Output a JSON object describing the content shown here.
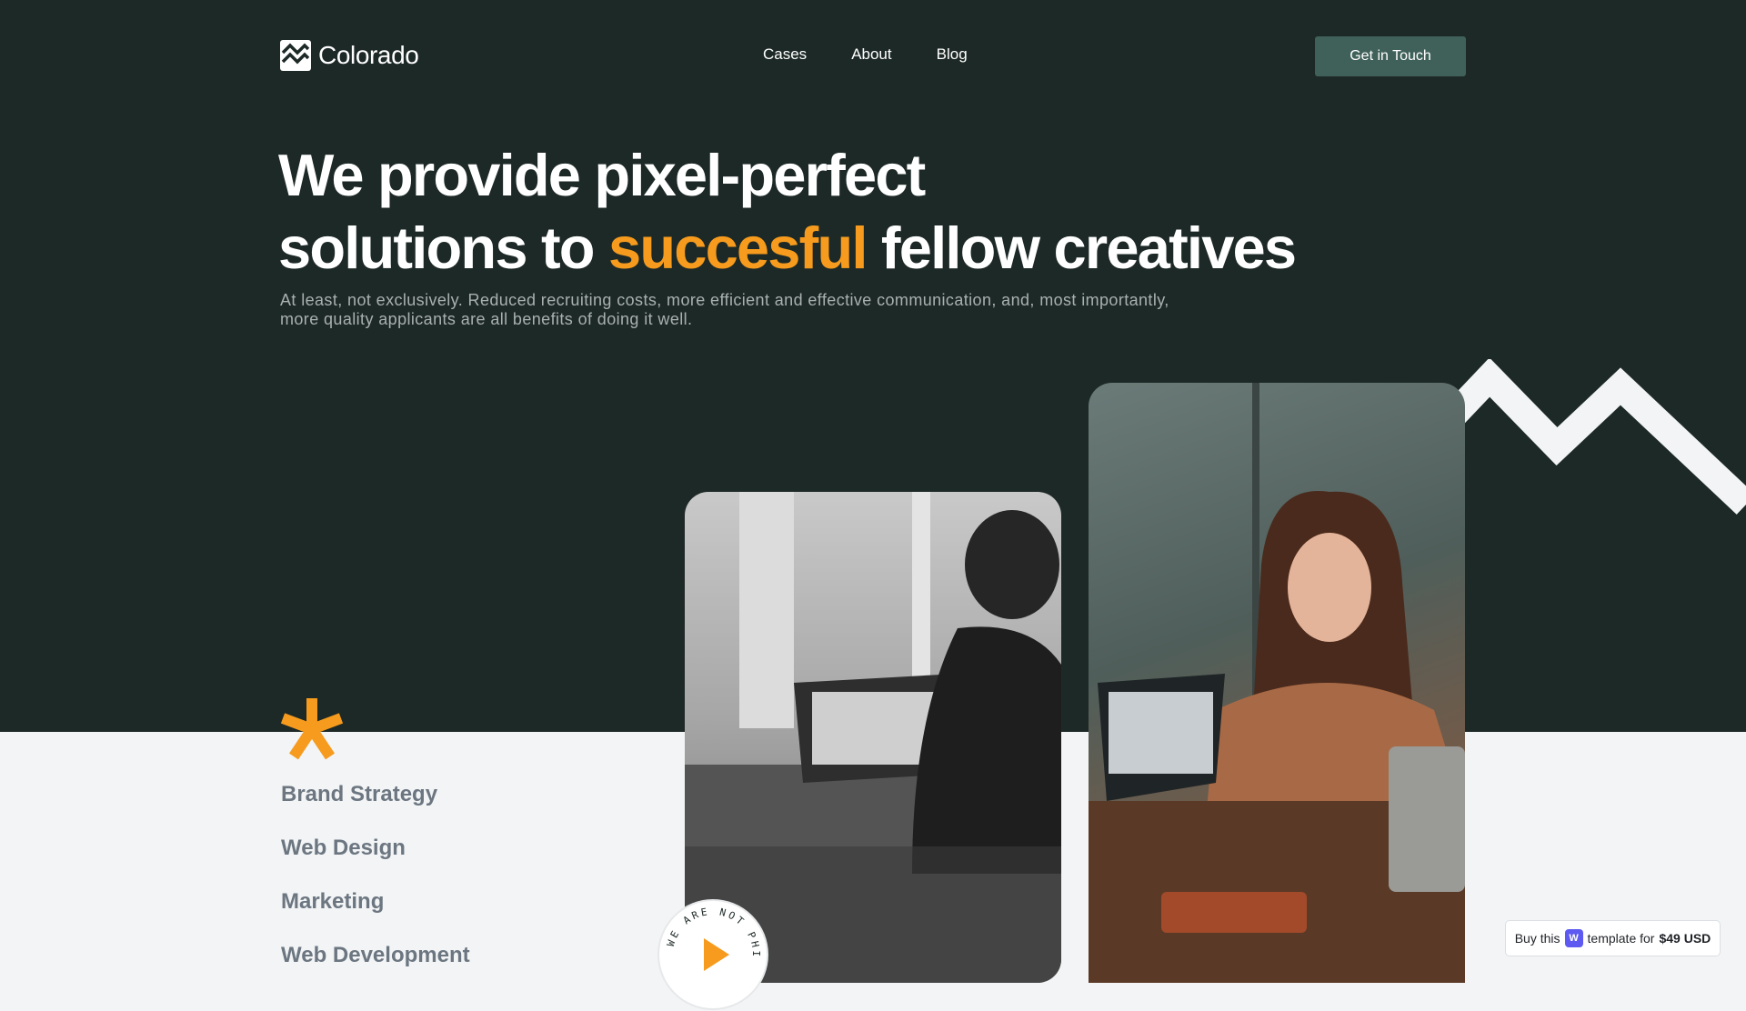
{
  "brand": {
    "name": "Colorado",
    "logo_icon": "mountain-logo-icon"
  },
  "nav": {
    "links": [
      "Cases",
      "About",
      "Blog"
    ],
    "cta_label": "Get in Touch"
  },
  "hero": {
    "headline_line1": "We provide pixel-perfect",
    "headline_line2_start": "solutions to",
    "headline_highlight": "succesful",
    "headline_line2_end": "fellow creatives",
    "subtext": "At least, not exclusively. Reduced recruiting costs, more efficient and effective communication, and, most importantly, more quality applicants are all benefits of doing it well."
  },
  "services": [
    "Brand Strategy",
    "Web Design",
    "Marketing",
    "Web Development"
  ],
  "badge": {
    "circular_text": "WE ARE NOT PHI",
    "icon": "play-icon"
  },
  "buy": {
    "prefix": "Buy this",
    "suffix": "template for",
    "price": "$49 USD",
    "icon": "webflow-icon"
  },
  "colors": {
    "hero_bg": "#1d2927",
    "accent": "#f69b1d",
    "cta_bg": "#40615a",
    "page_bg": "#f2f4f5"
  }
}
